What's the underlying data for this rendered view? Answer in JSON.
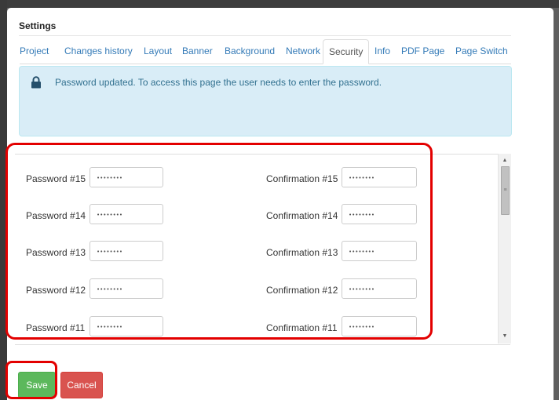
{
  "dialog": {
    "title": "Settings"
  },
  "tabs": [
    {
      "label": "Project"
    },
    {
      "label": "Changes history"
    },
    {
      "label": "Layout"
    },
    {
      "label": "Banner"
    },
    {
      "label": "Background"
    },
    {
      "label": "Network"
    },
    {
      "label": "Security",
      "active": true
    },
    {
      "label": "Info"
    },
    {
      "label": "PDF Page"
    },
    {
      "label": "Page Switch"
    }
  ],
  "alert": {
    "icon": "lock-icon",
    "text": "Password updated. To access this page the user needs to enter the password."
  },
  "passwords": [
    {
      "label": "Password #15",
      "value": "••••••••",
      "confirm_label": "Confirmation #15",
      "confirm_value": "••••••••"
    },
    {
      "label": "Password #14",
      "value": "••••••••",
      "confirm_label": "Confirmation #14",
      "confirm_value": "••••••••"
    },
    {
      "label": "Password #13",
      "value": "••••••••",
      "confirm_label": "Confirmation #13",
      "confirm_value": "••••••••"
    },
    {
      "label": "Password #12",
      "value": "••••••••",
      "confirm_label": "Confirmation #12",
      "confirm_value": "••••••••"
    },
    {
      "label": "Password #11",
      "value": "••••••••",
      "confirm_label": "Confirmation #11",
      "confirm_value": "••••••••"
    }
  ],
  "buttons": {
    "save": "Save",
    "cancel": "Cancel"
  },
  "colors": {
    "save": "#5cb85c",
    "cancel": "#d9534f",
    "alert_bg": "#d9edf7",
    "highlight": "#e30000",
    "link": "#337ab7"
  }
}
